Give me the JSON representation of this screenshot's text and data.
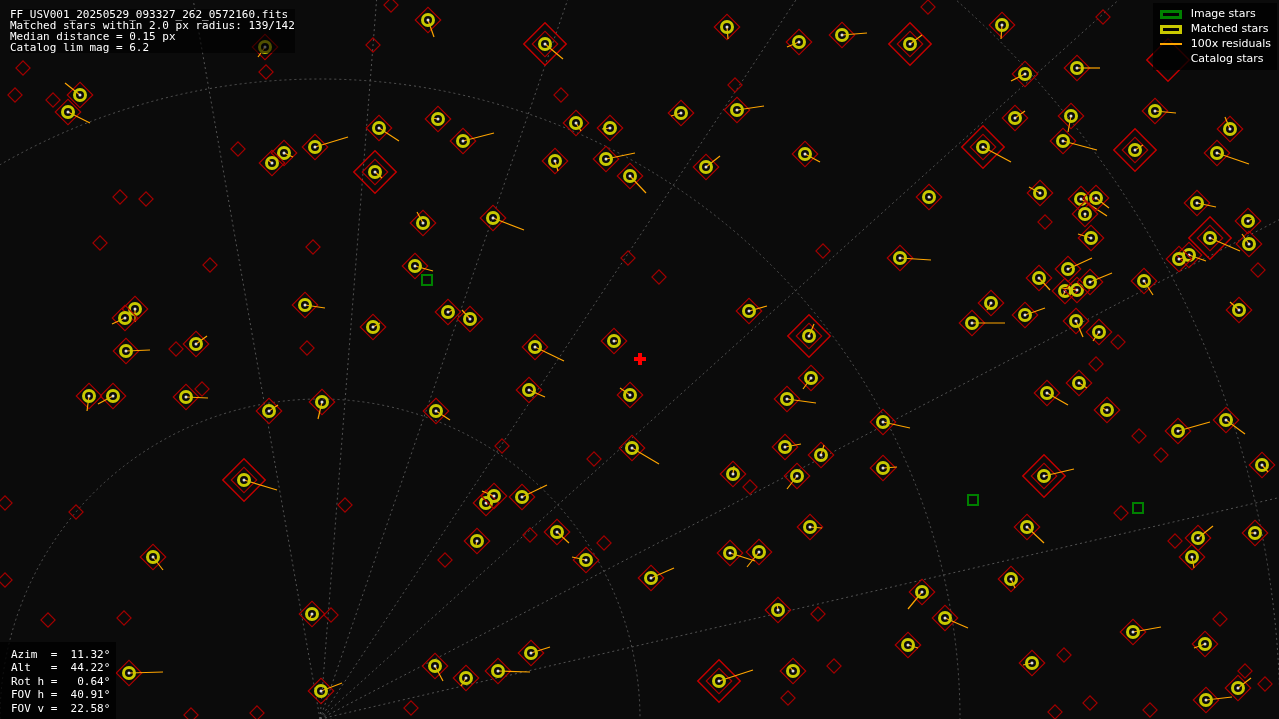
{
  "header_lines": [
    "FF_USV001_20250529_093327_262_0572160.fits",
    "Matched stars within 2.0 px radius: 139/142",
    "Median distance = 0.15 px",
    "Catalog lim mag = 6.2"
  ],
  "legend": [
    {
      "label": "Image stars",
      "kind": "box",
      "color": "#008000"
    },
    {
      "label": "Matched stars",
      "kind": "box",
      "color": "#c8c800"
    },
    {
      "label": "100x residuals",
      "kind": "line",
      "color": "#ffa500"
    },
    {
      "label": "Catalog stars",
      "kind": "none"
    }
  ],
  "pointing": [
    "Azim  =  11.32°",
    "Alt   =  44.22°",
    "Rot h =   0.64°",
    "FOV h =  40.91°",
    "FOV v =  22.58°"
  ]
}
